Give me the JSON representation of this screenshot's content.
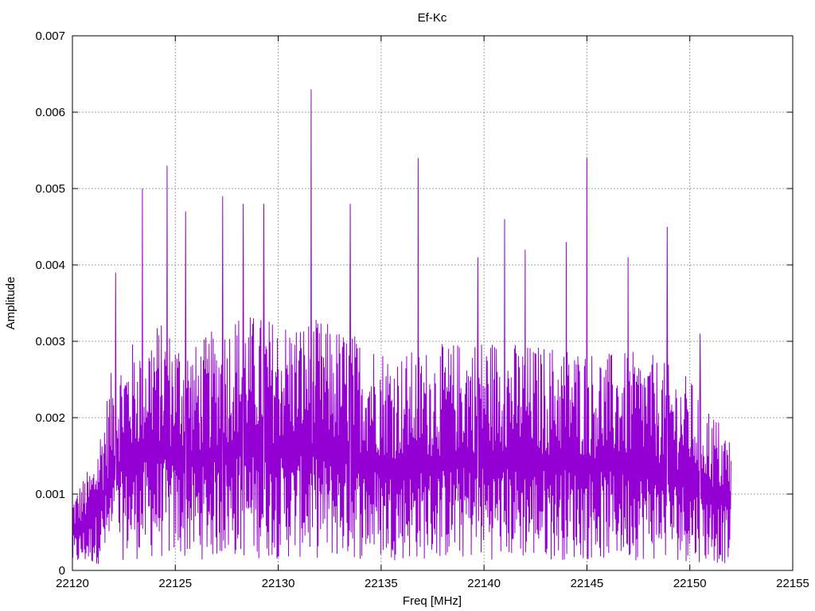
{
  "chart_data": {
    "type": "line",
    "title": "Ef-Kc",
    "xlabel": "Freq [MHz]",
    "ylabel": "Amplitude",
    "xlim": [
      22120,
      22155
    ],
    "ylim": [
      0,
      0.007
    ],
    "x_ticks": [
      "22120",
      "22125",
      "22130",
      "22135",
      "22140",
      "22145",
      "22150",
      "22155"
    ],
    "y_ticks": [
      "0",
      "0.001",
      "0.002",
      "0.003",
      "0.004",
      "0.005",
      "0.006",
      "0.007"
    ],
    "grid": true,
    "legend": "none",
    "series": [
      {
        "color": "#9400d3",
        "x_range": [
          22120,
          22152
        ],
        "peaks": [
          {
            "x": 22122.1,
            "y": 0.0039
          },
          {
            "x": 22123.4,
            "y": 0.005
          },
          {
            "x": 22124.6,
            "y": 0.0053
          },
          {
            "x": 22125.5,
            "y": 0.0047
          },
          {
            "x": 22127.3,
            "y": 0.0049
          },
          {
            "x": 22128.3,
            "y": 0.0048
          },
          {
            "x": 22129.3,
            "y": 0.0048
          },
          {
            "x": 22131.6,
            "y": 0.0063
          },
          {
            "x": 22133.5,
            "y": 0.0048
          },
          {
            "x": 22136.8,
            "y": 0.0054
          },
          {
            "x": 22139.7,
            "y": 0.0041
          },
          {
            "x": 22141.0,
            "y": 0.0046
          },
          {
            "x": 22142.0,
            "y": 0.0042
          },
          {
            "x": 22144.0,
            "y": 0.0043
          },
          {
            "x": 22145.0,
            "y": 0.0054
          },
          {
            "x": 22147.0,
            "y": 0.0041
          },
          {
            "x": 22148.9,
            "y": 0.0045
          },
          {
            "x": 22150.5,
            "y": 0.0031
          }
        ],
        "envelope": [
          {
            "x": 22120.0,
            "y": 0.0009
          },
          {
            "x": 22121.0,
            "y": 0.0013
          },
          {
            "x": 22122.0,
            "y": 0.0025
          },
          {
            "x": 22124.0,
            "y": 0.003
          },
          {
            "x": 22126.0,
            "y": 0.0027
          },
          {
            "x": 22128.0,
            "y": 0.0031
          },
          {
            "x": 22130.0,
            "y": 0.003
          },
          {
            "x": 22132.0,
            "y": 0.003
          },
          {
            "x": 22134.0,
            "y": 0.0028
          },
          {
            "x": 22136.0,
            "y": 0.0026
          },
          {
            "x": 22138.0,
            "y": 0.0027
          },
          {
            "x": 22140.0,
            "y": 0.0028
          },
          {
            "x": 22142.0,
            "y": 0.0027
          },
          {
            "x": 22144.0,
            "y": 0.0027
          },
          {
            "x": 22146.0,
            "y": 0.0026
          },
          {
            "x": 22148.0,
            "y": 0.0026
          },
          {
            "x": 22150.0,
            "y": 0.0023
          },
          {
            "x": 22152.0,
            "y": 0.0016
          }
        ]
      }
    ]
  }
}
